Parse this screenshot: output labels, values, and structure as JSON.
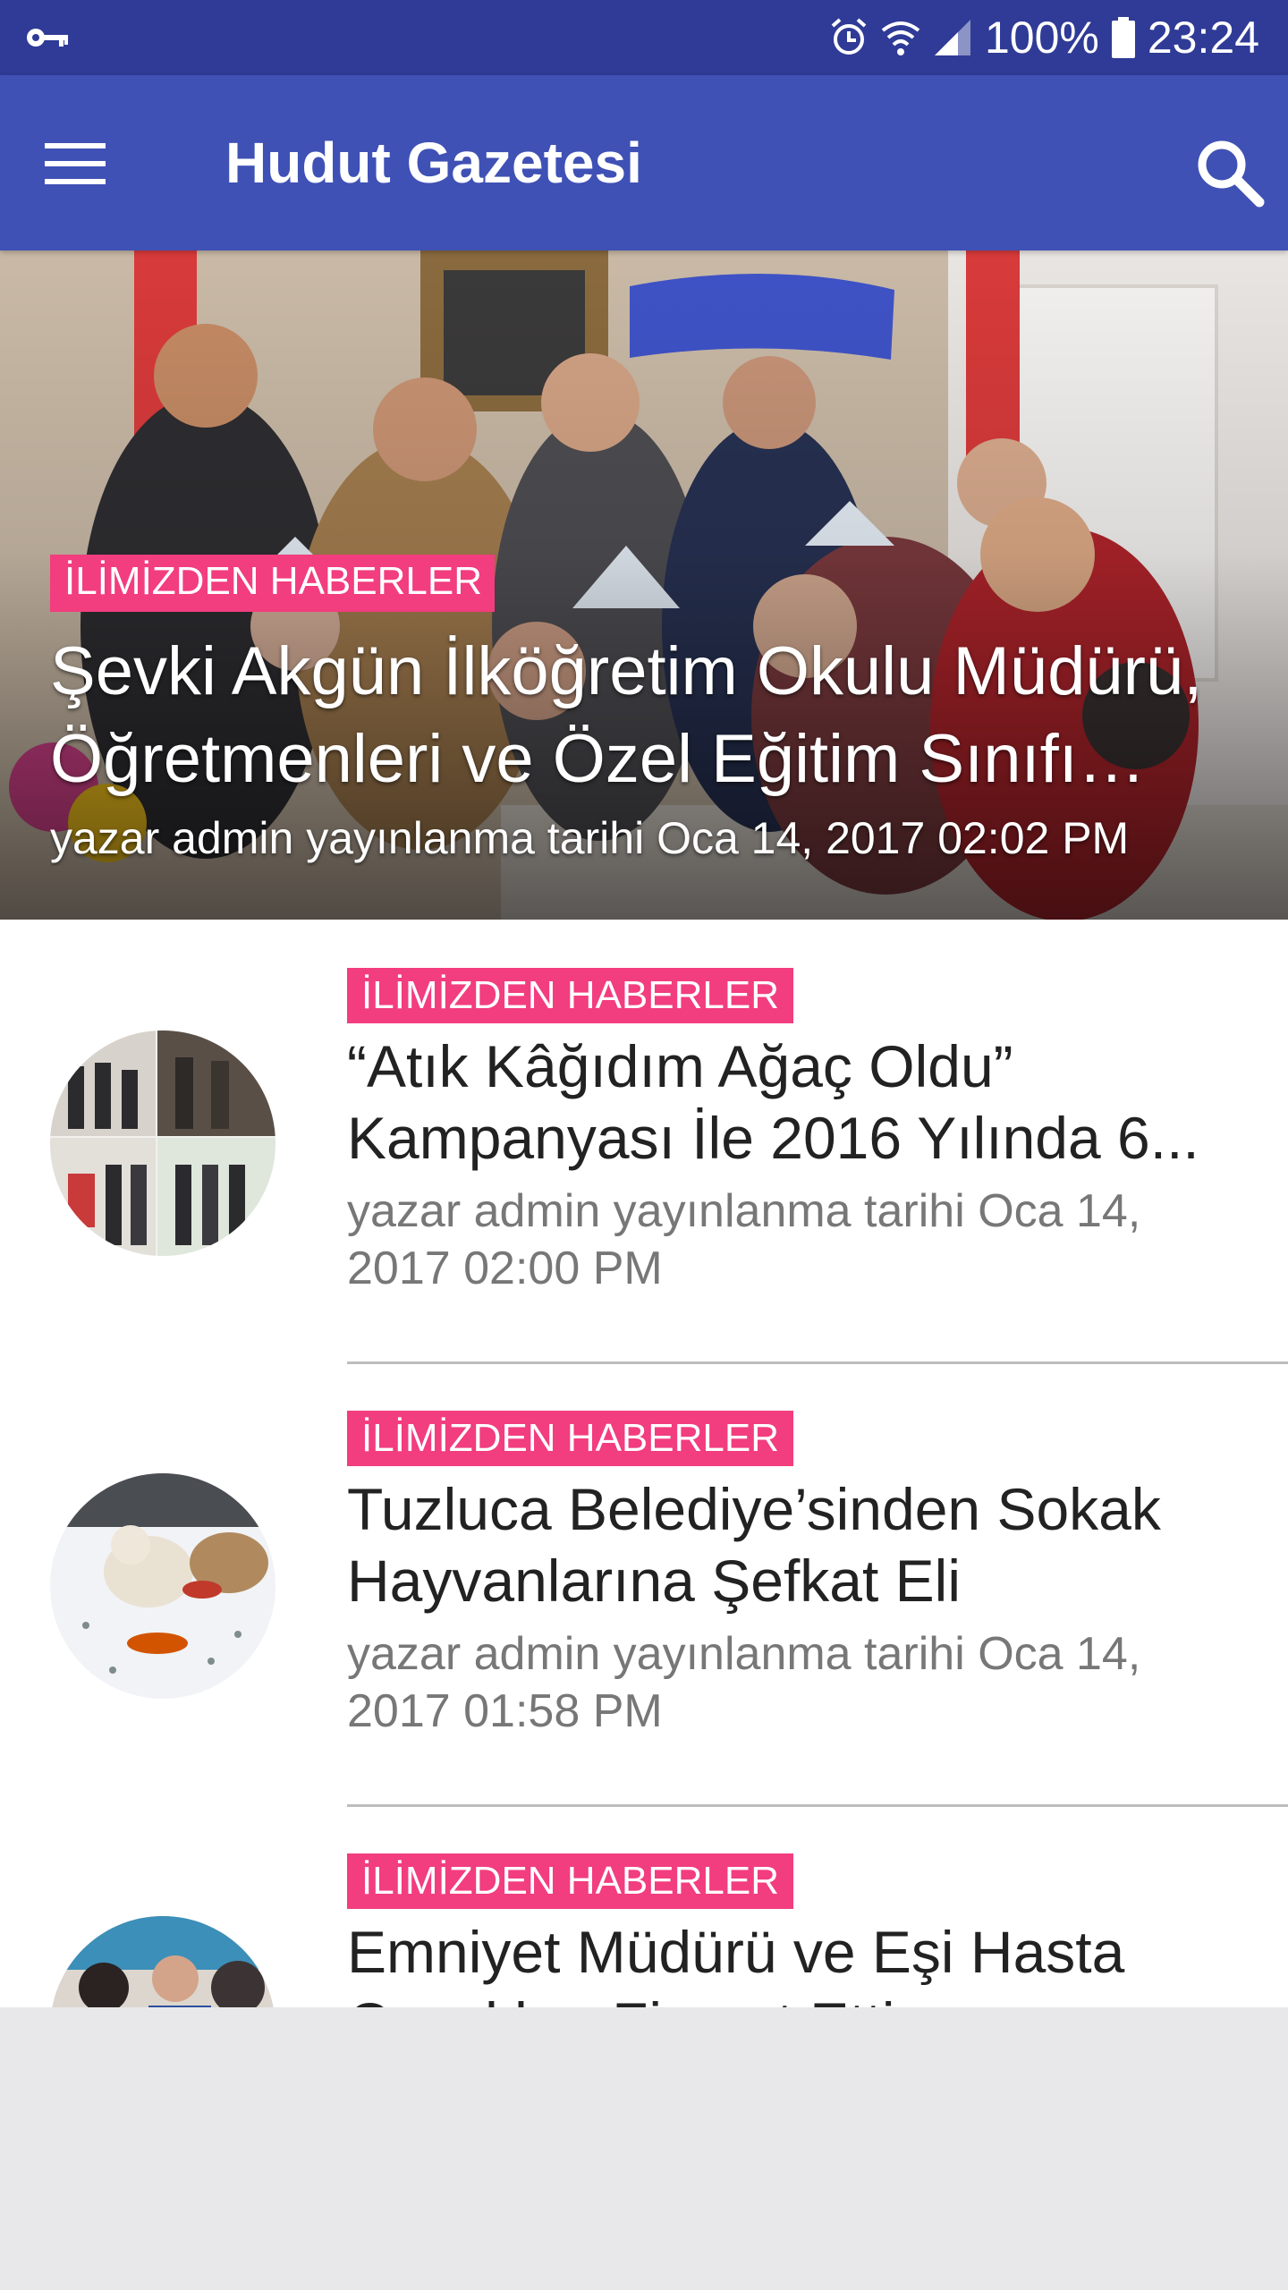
{
  "status_bar": {
    "battery": "100%",
    "time": "23:24",
    "icons": [
      "key-icon",
      "alarm-icon",
      "wifi-icon",
      "signal-icon",
      "battery-icon"
    ]
  },
  "app_bar": {
    "title": "Hudut Gazetesi",
    "menu_icon": "hamburger-menu-icon",
    "search_icon": "search-icon",
    "color": "#3f51b5"
  },
  "featured": {
    "category": "İLİMİZDEN HABERLER",
    "title": "Şevki Akgün İlköğretim Okulu Müdürü, Öğretmenleri ve Özel Eğitim Sınıfı Öğrencileri",
    "meta": "yazar admin yayınlanma tarihi Oca 14, 2017 02:02 PM"
  },
  "articles": [
    {
      "category": "İLİMİZDEN HABERLER",
      "title": "“Atık Kâğıdım Ağaç Oldu” Kampanyası İle 2016 Yılında 6...",
      "meta": "yazar admin yayınlanma tarihi  Oca 14, 2017 02:00 PM"
    },
    {
      "category": "İLİMİZDEN HABERLER",
      "title": "Tuzluca Belediye’sinden Sokak Hayvanlarına Şefkat Eli",
      "meta": "yazar admin yayınlanma tarihi  Oca 14, 2017 01:58 PM"
    },
    {
      "category": "İLİMİZDEN HABERLER",
      "title": "Emniyet Müdürü ve Eşi Hasta Çocukları Ziyaret Etti",
      "meta": ""
    }
  ],
  "colors": {
    "status_bar": "#2f3b96",
    "badge": "#f23d7e",
    "title_text": "#222222",
    "meta_text": "#777777"
  }
}
